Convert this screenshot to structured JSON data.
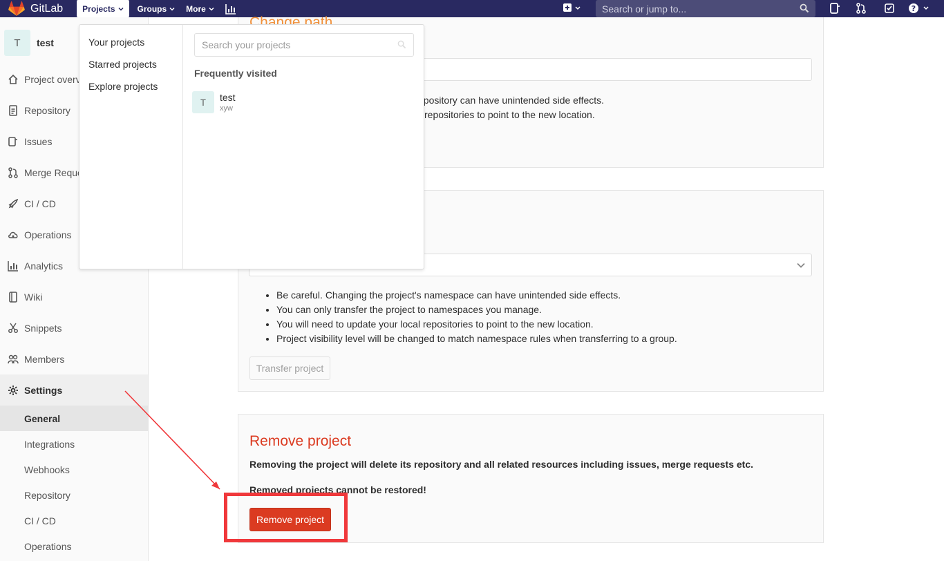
{
  "navbar": {
    "brand": "GitLab",
    "projects_label": "Projects",
    "groups_label": "Groups",
    "more_label": "More",
    "search_placeholder": "Search or jump to...",
    "background": "#292961"
  },
  "sidebar": {
    "project_initial": "T",
    "project_name": "test",
    "items": [
      {
        "label": "Project overview",
        "icon": "home-icon"
      },
      {
        "label": "Repository",
        "icon": "doc-icon"
      },
      {
        "label": "Issues",
        "icon": "issues-icon"
      },
      {
        "label": "Merge Requests",
        "icon": "merge-request-icon"
      },
      {
        "label": "CI / CD",
        "icon": "rocket-icon"
      },
      {
        "label": "Operations",
        "icon": "cloud-icon"
      },
      {
        "label": "Analytics",
        "icon": "chart-icon"
      },
      {
        "label": "Wiki",
        "icon": "book-icon"
      },
      {
        "label": "Snippets",
        "icon": "scissors-icon"
      },
      {
        "label": "Members",
        "icon": "users-icon"
      },
      {
        "label": "Settings",
        "icon": "gear-icon"
      }
    ],
    "settings_sub": [
      "General",
      "Integrations",
      "Webhooks",
      "Repository",
      "CI / CD",
      "Operations"
    ]
  },
  "dropdown": {
    "links": [
      "Your projects",
      "Starred projects",
      "Explore projects"
    ],
    "search_placeholder": "Search your projects",
    "heading": "Frequently visited",
    "project": {
      "initial": "T",
      "name": "test",
      "namespace": "xyw"
    }
  },
  "rename": {
    "line1": "epository can have unintended side effects.",
    "line2": "repositories to point to the new location."
  },
  "transfer": {
    "bullets": [
      "Be careful. Changing the project's namespace can have unintended side effects.",
      "You can only transfer the project to namespaces you manage.",
      "You will need to update your local repositories to point to the new location.",
      "Project visibility level will be changed to match namespace rules when transferring to a group."
    ],
    "button": "Transfer project"
  },
  "remove": {
    "title": "Remove project",
    "description": "Removing the project will delete its repository and all related resources including issues, merge requests etc.",
    "warning": "Removed projects cannot be restored!",
    "button": "Remove project",
    "color": "#db3b21"
  }
}
